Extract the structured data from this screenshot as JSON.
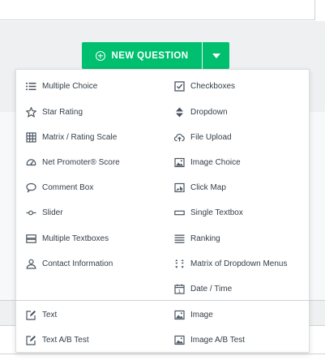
{
  "toolbar": {
    "new_question_label": "NEW QUESTION"
  },
  "menu": {
    "items": [
      {
        "label": "Multiple Choice",
        "icon": "list-icon"
      },
      {
        "label": "Checkboxes",
        "icon": "checkbox-icon"
      },
      {
        "label": "Star Rating",
        "icon": "star-icon"
      },
      {
        "label": "Dropdown",
        "icon": "dropdown-arrows-icon"
      },
      {
        "label": "Matrix / Rating Scale",
        "icon": "grid-icon"
      },
      {
        "label": "File Upload",
        "icon": "cloud-upload-icon"
      },
      {
        "label": "Net Promoter® Score",
        "icon": "gauge-icon"
      },
      {
        "label": "Image Choice",
        "icon": "image-icon"
      },
      {
        "label": "Comment Box",
        "icon": "speech-bubble-icon"
      },
      {
        "label": "Click Map",
        "icon": "click-map-icon"
      },
      {
        "label": "Slider",
        "icon": "slider-icon"
      },
      {
        "label": "Single Textbox",
        "icon": "textbox-icon"
      },
      {
        "label": "Multiple Textboxes",
        "icon": "multiple-textboxes-icon"
      },
      {
        "label": "Ranking",
        "icon": "ranking-lines-icon"
      },
      {
        "label": "Contact Information",
        "icon": "person-icon"
      },
      {
        "label": "Matrix of Dropdown Menus",
        "icon": "matrix-dropdown-icon"
      },
      {
        "label": "Date / Time",
        "icon": "calendar-icon"
      }
    ],
    "extra_items": [
      {
        "label": "Text",
        "icon": "edit-icon"
      },
      {
        "label": "Image",
        "icon": "image-icon"
      },
      {
        "label": "Text A/B Test",
        "icon": "edit-icon"
      },
      {
        "label": "Image A/B Test",
        "icon": "image-icon"
      }
    ]
  },
  "colors": {
    "accent": "#00bf6f",
    "text": "#333e48",
    "icon": "#4a5560"
  }
}
